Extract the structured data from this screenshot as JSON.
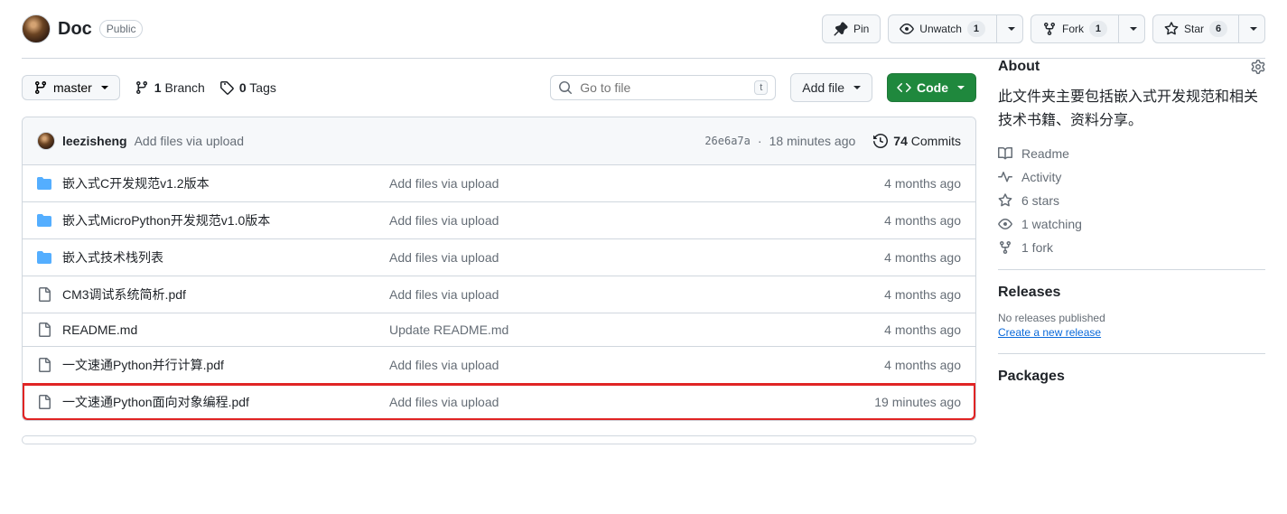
{
  "header": {
    "repo_name": "Doc",
    "visibility": "Public",
    "buttons": {
      "pin": "Pin",
      "watch": "Unwatch",
      "watch_count": "1",
      "fork": "Fork",
      "fork_count": "1",
      "star": "Star",
      "star_count": "6"
    }
  },
  "toolbar": {
    "branch": "master",
    "branches_count": "1",
    "branches_label": "Branch",
    "tags_count": "0",
    "tags_label": "Tags",
    "search_placeholder": "Go to file",
    "search_kbd": "t",
    "add_file": "Add file",
    "code": "Code"
  },
  "commit": {
    "author": "leezisheng",
    "message": "Add files via upload",
    "sha": "26e6a7a",
    "time": "18 minutes ago",
    "commits_count": "74",
    "commits_label": "Commits"
  },
  "files": [
    {
      "type": "folder",
      "name": "嵌入式C开发规范v1.2版本",
      "msg": "Add files via upload",
      "time": "4 months ago"
    },
    {
      "type": "folder",
      "name": "嵌入式MicroPython开发规范v1.0版本",
      "msg": "Add files via upload",
      "time": "4 months ago"
    },
    {
      "type": "folder",
      "name": "嵌入式技术栈列表",
      "msg": "Add files via upload",
      "time": "4 months ago"
    },
    {
      "type": "file",
      "name": "CM3调试系统简析.pdf",
      "msg": "Add files via upload",
      "time": "4 months ago"
    },
    {
      "type": "file",
      "name": "README.md",
      "msg": "Update README.md",
      "time": "4 months ago"
    },
    {
      "type": "file",
      "name": "一文速通Python并行计算.pdf",
      "msg": "Add files via upload",
      "time": "4 months ago"
    },
    {
      "type": "file",
      "name": "一文速通Python面向对象编程.pdf",
      "msg": "Add files via upload",
      "time": "19 minutes ago",
      "highlight": true
    }
  ],
  "about": {
    "heading": "About",
    "description": "此文件夹主要包括嵌入式开发规范和相关技术书籍、资料分享。",
    "items": {
      "readme": "Readme",
      "activity": "Activity",
      "stars": "6 stars",
      "watching": "1 watching",
      "forks": "1 fork"
    }
  },
  "releases": {
    "heading": "Releases",
    "empty": "No releases published",
    "create": "Create a new release"
  },
  "packages": {
    "heading": "Packages"
  }
}
